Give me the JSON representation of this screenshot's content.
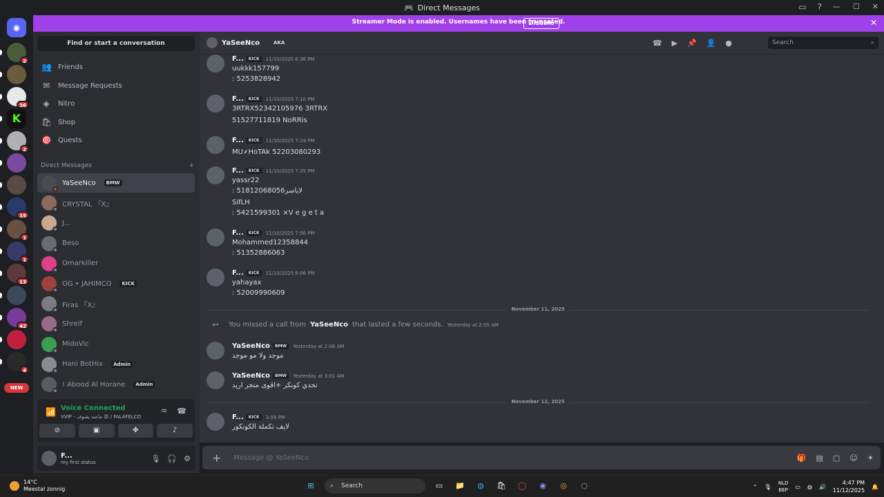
{
  "window": {
    "title": "Direct Messages"
  },
  "banner": {
    "text": "Streamer Mode is enabled. Usernames have been truncated.",
    "disable_label": "Disable"
  },
  "guilds": [
    {
      "badge": "2"
    },
    {
      "badge": ""
    },
    {
      "badge": "36"
    },
    {
      "badge": ""
    },
    {
      "badge": "2"
    },
    {
      "badge": ""
    },
    {
      "badge": ""
    },
    {
      "badge": "15"
    },
    {
      "badge": "1"
    },
    {
      "badge": "1"
    },
    {
      "badge": "13"
    },
    {
      "badge": ""
    },
    {
      "badge": "42"
    },
    {
      "badge": ""
    },
    {
      "badge": "4"
    }
  ],
  "guild_new_label": "NEW",
  "sidebar": {
    "search_label": "Find or start a conversation",
    "nav": [
      "Friends",
      "Message Requests",
      "Nitro",
      "Shop",
      "Quests"
    ],
    "dm_header": "Direct Messages",
    "dms": [
      {
        "name": "YaSeeNco",
        "tag": "BMW",
        "active": true
      },
      {
        "name": "CRYSTAL 『X』",
        "tag": ""
      },
      {
        "name": "J...",
        "tag": ""
      },
      {
        "name": "Beso",
        "tag": ""
      },
      {
        "name": "Omarkiller",
        "tag": ""
      },
      {
        "name": "OG • JAHIMCO",
        "tag": "KICK"
      },
      {
        "name": "Firas 『X』",
        "tag": ""
      },
      {
        "name": "Shreif",
        "tag": ""
      },
      {
        "name": "MidoVic",
        "tag": ""
      },
      {
        "name": "Hani BotHix",
        "tag": "Admin"
      },
      {
        "name": "! Abood Al Horane",
        "tag": "Admin"
      }
    ]
  },
  "voice": {
    "status": "Voice Connected",
    "channel": "VVIP - ماعند يشوف 😡 / FALAFELCO"
  },
  "user": {
    "name": "F...",
    "status": "my first status"
  },
  "header": {
    "name": "YaSeeNco",
    "aka": "AKA",
    "search_placeholder": "Search"
  },
  "messages": [
    {
      "author": "F...",
      "tag": "KICK",
      "time": "11/10/2025 6:36 PM",
      "lines": [
        "uukkk157799",
        ": 5253828942"
      ]
    },
    {
      "author": "F...",
      "tag": "KICK",
      "time": "11/10/2025 7:10 PM",
      "lines": [
        "3RTRX52342105976 3RTRX",
        "51527711819 NoRRis"
      ]
    },
    {
      "author": "F...",
      "tag": "KICK",
      "time": "11/10/2025 7:24 PM",
      "lines": [
        "MU⸙HoTAk 52203080293"
      ]
    },
    {
      "author": "F...",
      "tag": "KICK",
      "time": "11/10/2025 7:35 PM",
      "lines": [
        "yassr22",
        ": 51812068056لاياسر",
        "SifLH",
        ": 5421599301 ×V e g e t a"
      ]
    },
    {
      "author": "F...",
      "tag": "KICK",
      "time": "11/10/2025 7:56 PM",
      "lines": [
        "Mohammed12358844",
        ": 51352886063"
      ]
    },
    {
      "author": "F...",
      "tag": "KICK",
      "time": "11/10/2025 8:06 PM",
      "lines": [
        "yahayax",
        ": 52009990609"
      ]
    }
  ],
  "divider1": "November 11, 2025",
  "call": {
    "prefix": "You missed a call from",
    "name": "YaSeeNco",
    "suffix": "that lasted a few seconds.",
    "time": "Yesterday at 2:05 AM"
  },
  "messages2": [
    {
      "author": "YaSeeNco",
      "tag": "BMW",
      "time": "Yesterday at 2:06 AM",
      "lines": [
        "موجد ولا مو موجد"
      ]
    },
    {
      "author": "YaSeeNco",
      "tag": "BMW",
      "time": "Yesterday at 3:01 AM",
      "lines": [
        "تحدي كونكر +اقوى متجر اريد"
      ]
    }
  ],
  "divider2": "November 12, 2025",
  "messages3": [
    {
      "author": "F...",
      "tag": "KICK",
      "time": "3:09 PM",
      "lines": [
        "لايف تكملة الكونكور"
      ]
    }
  ],
  "composer": {
    "placeholder": "Message @ YaSeeNco"
  },
  "taskbar": {
    "temp": "14°C",
    "weather": "Meestal zonnig",
    "search": "Search",
    "lang1": "NLD",
    "lang2": "BEP",
    "time": "4:47 PM",
    "date": "11/12/2025"
  }
}
